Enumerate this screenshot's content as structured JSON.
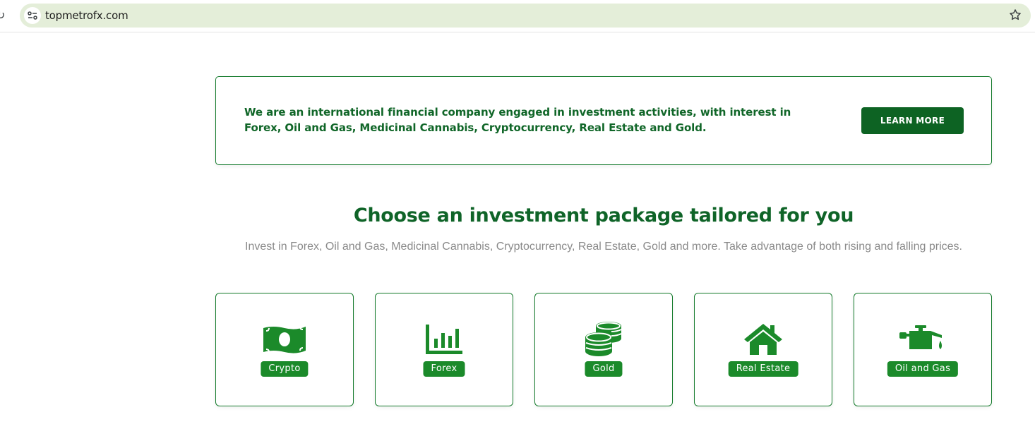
{
  "browser": {
    "url": "topmetrofx.com"
  },
  "about": {
    "text": "We are an international financial company engaged in investment activities, with interest in Forex, Oil and Gas, Medicinal Cannabis, Cryptocurrency, Real Estate and Gold.",
    "button_label": "LEARN MORE"
  },
  "packages": {
    "title": "Choose an investment package tailored for you",
    "subtitle": "Invest in Forex, Oil and Gas, Medicinal Cannabis, Cryptocurrency, Real Estate, Gold and more. Take advantage of both rising and falling prices.",
    "items": [
      {
        "label": "Crypto",
        "icon": "money-bill-icon"
      },
      {
        "label": "Forex",
        "icon": "bar-chart-icon"
      },
      {
        "label": "Gold",
        "icon": "coins-icon"
      },
      {
        "label": "Real Estate",
        "icon": "house-icon"
      },
      {
        "label": "Oil and Gas",
        "icon": "oil-can-icon"
      }
    ]
  },
  "colors": {
    "brand_green": "#0d6323",
    "accent_green": "#1b8a2a",
    "omnibox_bg": "#e4eed9",
    "subtitle_gray": "#8a8a8a"
  }
}
